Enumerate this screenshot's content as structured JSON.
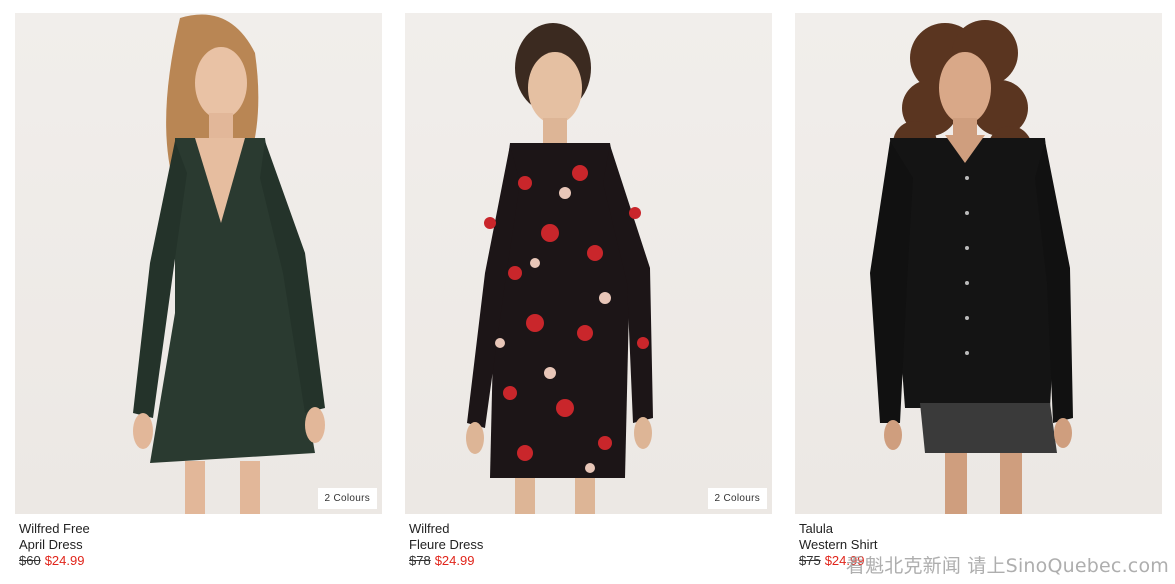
{
  "products": [
    {
      "brand": "Wilfred Free",
      "name": "April Dress",
      "original_price": "$60",
      "sale_price": "$24.99",
      "colours_badge": "2 Colours",
      "garment_color": "#2a3a30"
    },
    {
      "brand": "Wilfred",
      "name": "Fleure Dress",
      "original_price": "$78",
      "sale_price": "$24.99",
      "colours_badge": "2 Colours",
      "garment_color": "#1c1517"
    },
    {
      "brand": "Talula",
      "name": "Western Shirt",
      "original_price": "$75",
      "sale_price": "$24.99",
      "colours_badge": "",
      "garment_color": "#141414"
    }
  ],
  "watermark": "看魁北克新闻 请上SinoQuebec.com",
  "colors": {
    "sale": "#e1251b",
    "background": "#ffffff",
    "photo_bg": "#eeeae6"
  }
}
